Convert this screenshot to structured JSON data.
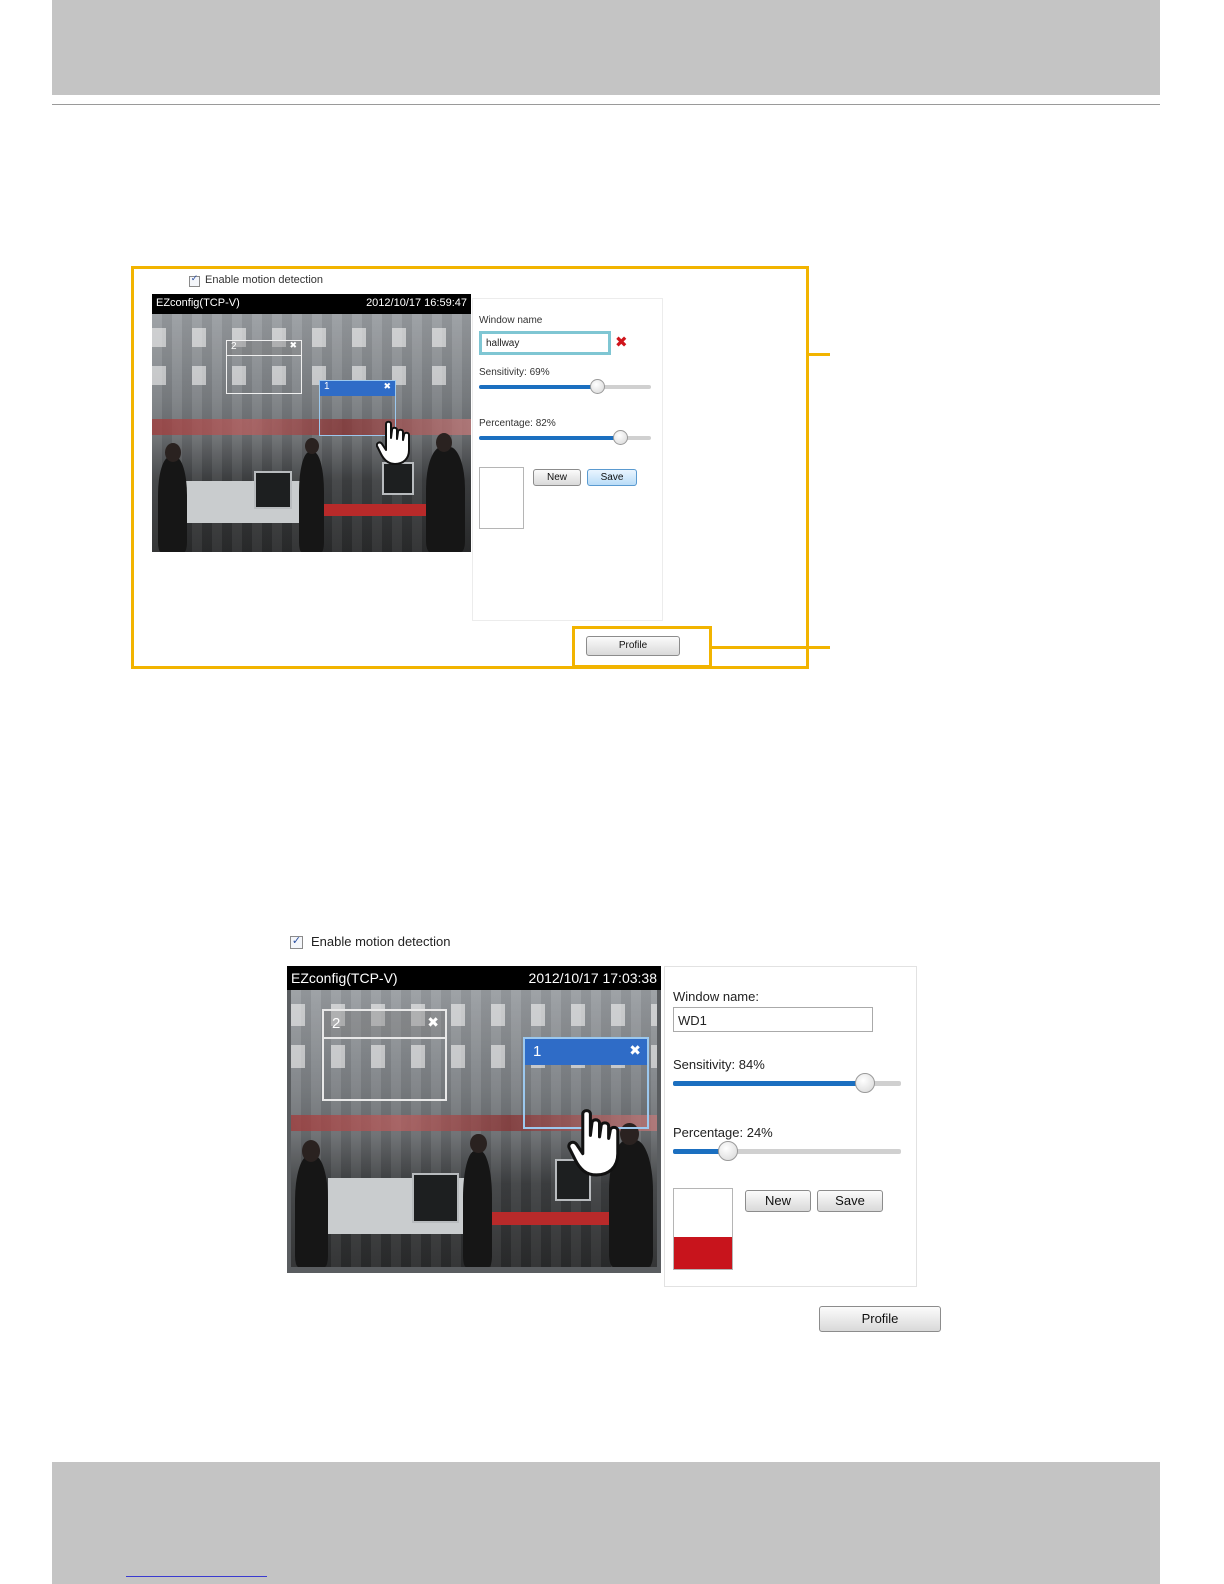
{
  "colors": {
    "callout": "#f2b400",
    "header_band": "#c4c4c4",
    "motion_window_active": "#2f6cc7",
    "slider_fill": "#1b6fc0",
    "level_fill": "#c8141c",
    "delete_icon": "#d0151c"
  },
  "figure1": {
    "enable_label": "Enable motion detection",
    "enable_checked": true,
    "video": {
      "source": "EZconfig(TCP-V)",
      "timestamp": "2012/10/17 16:59:47",
      "windows": [
        {
          "label": "2",
          "active": false,
          "close_icon": "close-icon"
        },
        {
          "label": "1",
          "active": true,
          "close_icon": "close-icon"
        }
      ]
    },
    "window_name_label": "Window name",
    "window_name_value": "hallway",
    "delete_icon": "red-x-icon",
    "sensitivity_label": "Sensitivity: 69%",
    "sensitivity_value": 69,
    "percentage_label": "Percentage: 82%",
    "percentage_value": 82,
    "new_label": "New",
    "save_label": "Save",
    "profile_label": "Profile"
  },
  "figure2": {
    "enable_label": "Enable motion detection",
    "enable_checked": true,
    "video": {
      "source": "EZconfig(TCP-V)",
      "timestamp": "2012/10/17 17:03:38",
      "windows": [
        {
          "label": "2",
          "active": false,
          "close_icon": "close-icon"
        },
        {
          "label": "1",
          "active": true,
          "close_icon": "close-icon"
        }
      ]
    },
    "window_name_label": "Window name:",
    "window_name_value": "WD1",
    "sensitivity_label": "Sensitivity: 84%",
    "sensitivity_value": 84,
    "percentage_label": "Percentage: 24%",
    "percentage_value": 24,
    "new_label": "New",
    "save_label": "Save",
    "profile_label": "Profile",
    "level_fraction": 0.4
  }
}
